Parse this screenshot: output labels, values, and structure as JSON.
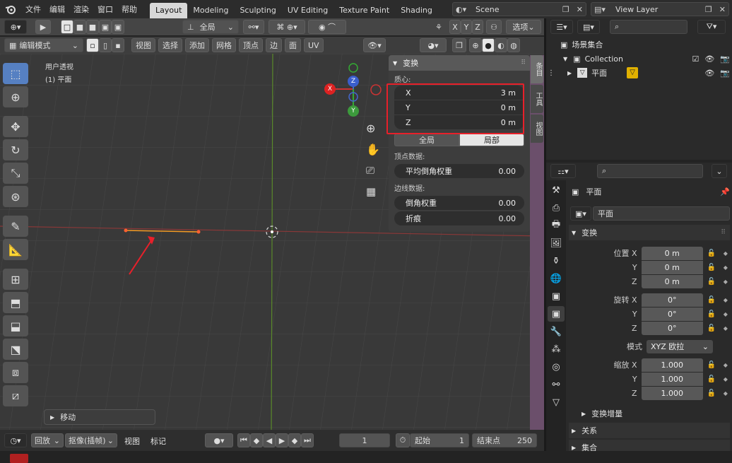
{
  "topbar": {
    "menus": [
      "文件",
      "编辑",
      "渲染",
      "窗口",
      "帮助"
    ],
    "workspaces": [
      "Layout",
      "Modeling",
      "Sculpting",
      "UV Editing",
      "Texture Paint",
      "Shading"
    ],
    "scene": "Scene",
    "view_layer": "View Layer"
  },
  "viewport_header": {
    "orientation": "全局",
    "axes": [
      "X",
      "Y",
      "Z"
    ],
    "options": "选项",
    "mode": "编辑模式",
    "menus": [
      "视图",
      "选择",
      "添加",
      "网格",
      "顶点",
      "边",
      "面",
      "UV"
    ]
  },
  "viewport": {
    "view_name": "用户透视",
    "object_name": "(1) 平面",
    "gizmo": {
      "x": "X",
      "y": "Y",
      "z": "Z"
    },
    "last_op": "移动"
  },
  "npanel": {
    "title": "变换",
    "median_label": "质心:",
    "rows": [
      {
        "axis": "X",
        "value": "3 m"
      },
      {
        "axis": "Y",
        "value": "0 m"
      },
      {
        "axis": "Z",
        "value": "0 m"
      }
    ],
    "global": "全局",
    "local": "局部",
    "vertex_data": "顶点数据:",
    "vertex_bevel": {
      "label": "平均倒角权重",
      "value": "0.00"
    },
    "edge_data": "边线数据:",
    "edge_bevel": {
      "label": "倒角权重",
      "value": "0.00"
    },
    "crease": {
      "label": "折痕",
      "value": "0.00"
    },
    "tabs": [
      "条目",
      "工具",
      "视图"
    ]
  },
  "outliner": {
    "scene_collection": "场景集合",
    "collection": "Collection",
    "object": "平面"
  },
  "properties": {
    "object_name": "平面",
    "data_name": "平面",
    "transform": "变换",
    "location_label": "位置",
    "rotation_label": "旋转",
    "scale_label": "缩放",
    "location": [
      "0 m",
      "0 m",
      "0 m"
    ],
    "rotation": [
      "0°",
      "0°",
      "0°"
    ],
    "mode_label": "模式",
    "mode_value": "XYZ 欧拉",
    "scale": [
      "1.000",
      "1.000",
      "1.000"
    ],
    "axes": [
      "X",
      "Y",
      "Z"
    ],
    "delta": "变换增量",
    "relations": "关系",
    "collections": "集合"
  },
  "timeline": {
    "playback": "回放",
    "keying": "抠像(插帧)",
    "view": "视图",
    "marker": "标记",
    "current_frame": "1",
    "start_label": "起始",
    "start": "1",
    "end_label": "结束点",
    "end": "250"
  },
  "colors": {
    "highlight": "#e8202a",
    "accent": "#5680c2",
    "edge_select": "#f59a23"
  }
}
